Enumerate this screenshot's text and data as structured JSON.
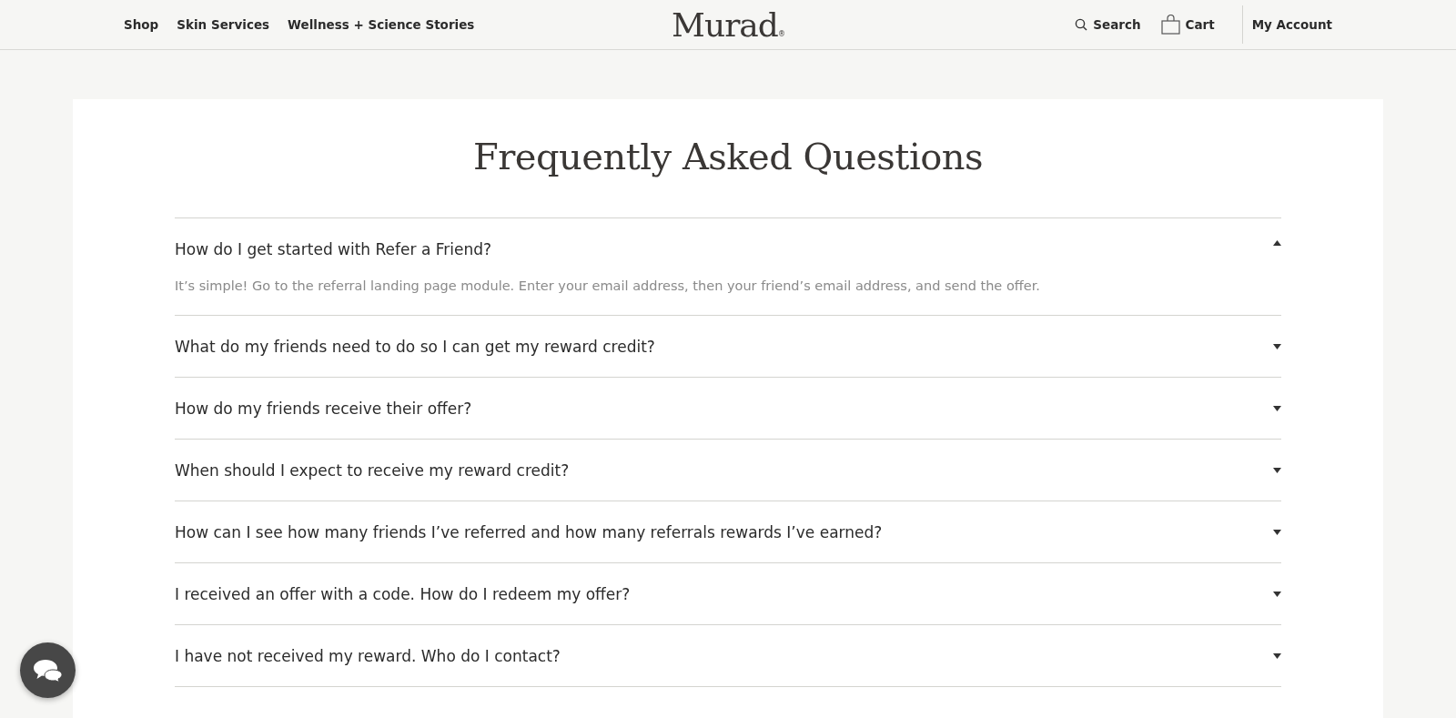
{
  "nav": {
    "links": [
      "Shop",
      "Skin Services",
      "Wellness + Science Stories"
    ],
    "logo": "Murad",
    "logo_mark": "®",
    "search": "Search",
    "cart": "Cart",
    "account": "My Account"
  },
  "faq": {
    "title": "Frequently Asked Questions",
    "items": [
      {
        "question": "How do I get started with Refer a Friend?",
        "expanded": true,
        "answer": "It’s simple! Go to the referral landing page module. Enter your email address, then your friend’s email address, and send the offer."
      },
      {
        "question": "What do my friends need to do so I can get my reward credit?",
        "expanded": false
      },
      {
        "question": "How do my friends receive their offer?",
        "expanded": false
      },
      {
        "question": "When should I expect to receive my reward credit?",
        "expanded": false
      },
      {
        "question": "How can I see how many friends I’ve referred and how many referrals rewards I’ve earned?",
        "expanded": false
      },
      {
        "question": "I received an offer with a code. How do I redeem my offer?",
        "expanded": false
      },
      {
        "question": "I have not received my reward. Who do I contact?",
        "expanded": false
      }
    ]
  }
}
